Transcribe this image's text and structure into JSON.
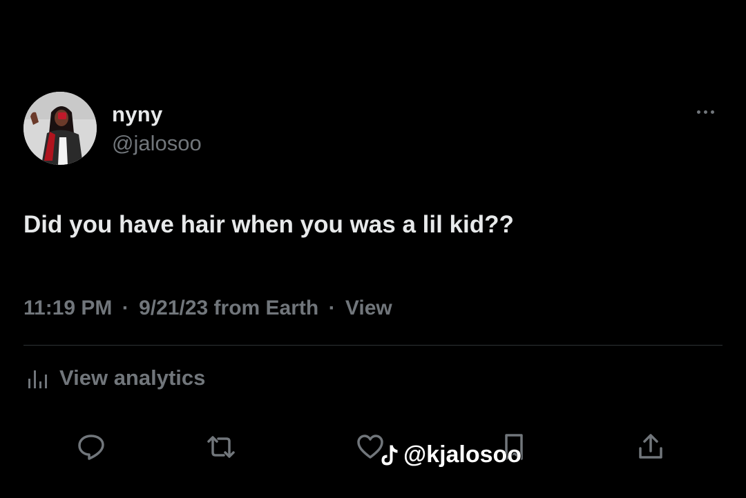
{
  "tweet": {
    "display_name": "nyny",
    "handle": "@jalosoo",
    "text": "Did you have hair when you was a lil kid??",
    "time": "11:19 PM",
    "date": "9/21/23",
    "source": "from Earth",
    "views_label": "View",
    "separator": "·"
  },
  "analytics": {
    "label": "View analytics",
    "icon": "bar-chart-icon"
  },
  "actions": [
    {
      "name": "reply",
      "icon": "comment-icon"
    },
    {
      "name": "retweet",
      "icon": "retweet-icon"
    },
    {
      "name": "like",
      "icon": "heart-icon"
    },
    {
      "name": "bookmark",
      "icon": "bookmark-icon"
    },
    {
      "name": "share",
      "icon": "share-icon"
    }
  ],
  "watermark": {
    "text": "@kjalosoo",
    "icon": "tiktok-icon"
  },
  "colors": {
    "background": "#000000",
    "primary_text": "#e7e9ea",
    "secondary_text": "#71767b",
    "divider": "#2f3336"
  }
}
